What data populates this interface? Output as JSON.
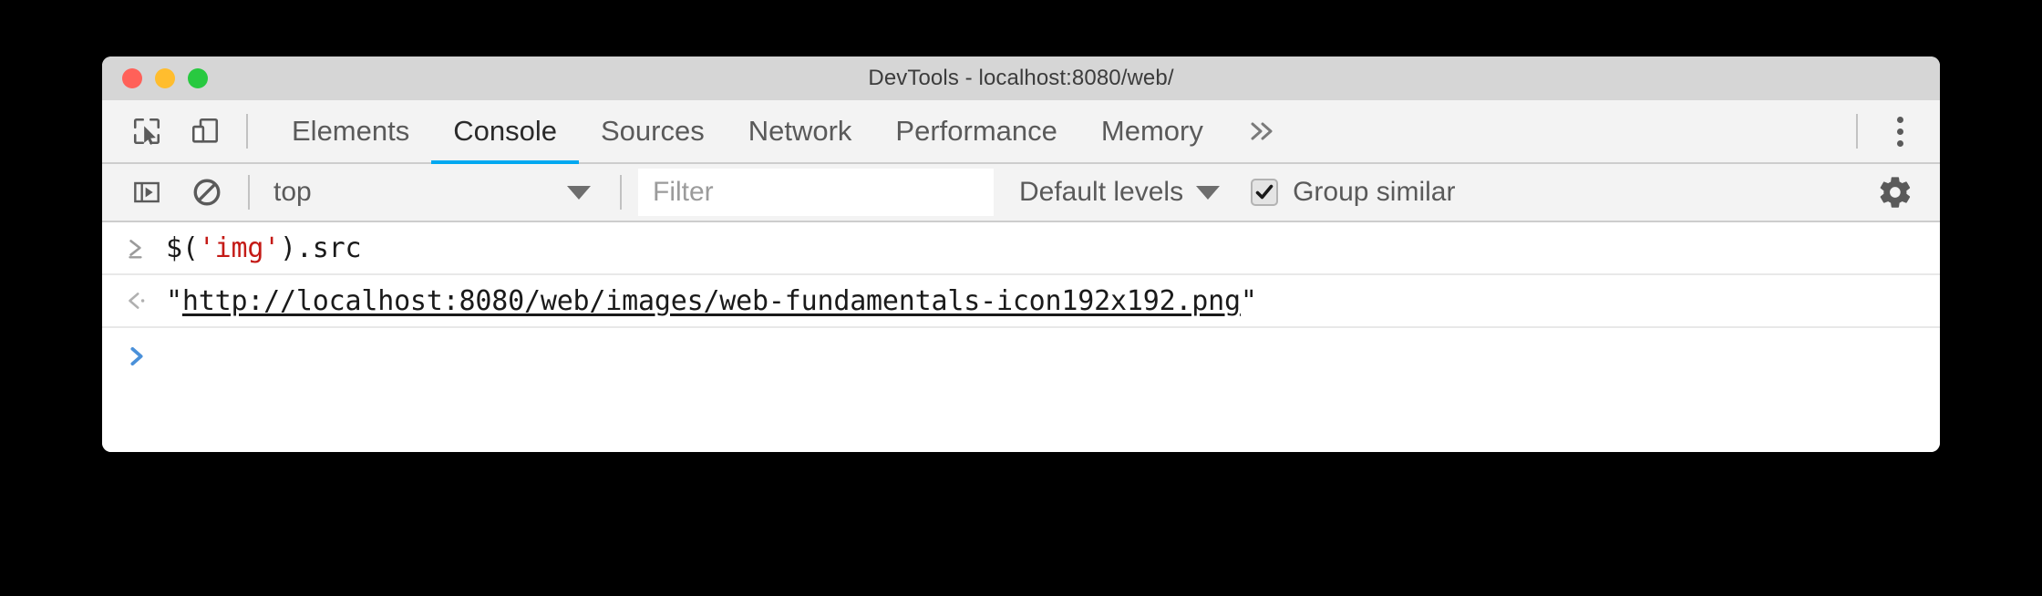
{
  "window": {
    "title": "DevTools - localhost:8080/web/",
    "traffic_lights": [
      {
        "name": "close",
        "color": "#ff6159"
      },
      {
        "name": "minimize",
        "color": "#ffbd2e"
      },
      {
        "name": "maximize",
        "color": "#28c940"
      }
    ]
  },
  "main_tabbar": {
    "inspect_icon": "inspect-element-icon",
    "device_icon": "device-toolbar-icon",
    "tabs": [
      {
        "label": "Elements",
        "active": false
      },
      {
        "label": "Console",
        "active": true
      },
      {
        "label": "Sources",
        "active": false
      },
      {
        "label": "Network",
        "active": false
      },
      {
        "label": "Performance",
        "active": false
      },
      {
        "label": "Memory",
        "active": false
      }
    ],
    "overflow_label": "»",
    "kebab_icon": "more-options-icon",
    "active_underline_color": "#00a8f0"
  },
  "console_toolbar": {
    "sidebar_icon": "console-sidebar-icon",
    "clear_icon": "clear-console-icon",
    "context": {
      "value": "top",
      "chevron": "chevron-down-icon"
    },
    "filter": {
      "value": "",
      "placeholder": "Filter"
    },
    "levels": {
      "value": "Default levels",
      "chevron": "chevron-down-icon"
    },
    "group_similar": {
      "label": "Group similar",
      "checked": true
    },
    "settings_icon": "gear-icon"
  },
  "console": {
    "rows": [
      {
        "type": "input",
        "gutter_icon": "input-prompt-icon",
        "code_prefix": "$(",
        "code_string": "'img'",
        "code_suffix": ").src"
      },
      {
        "type": "result",
        "gutter_icon": "output-result-icon",
        "quote_open": "\"",
        "url": "http://localhost:8080/web/images/web-fundamentals-icon192x192.png",
        "quote_close": "\""
      }
    ],
    "prompt": {
      "icon": "prompt-chevron-icon",
      "color": "#4a90d9",
      "value": ""
    }
  }
}
